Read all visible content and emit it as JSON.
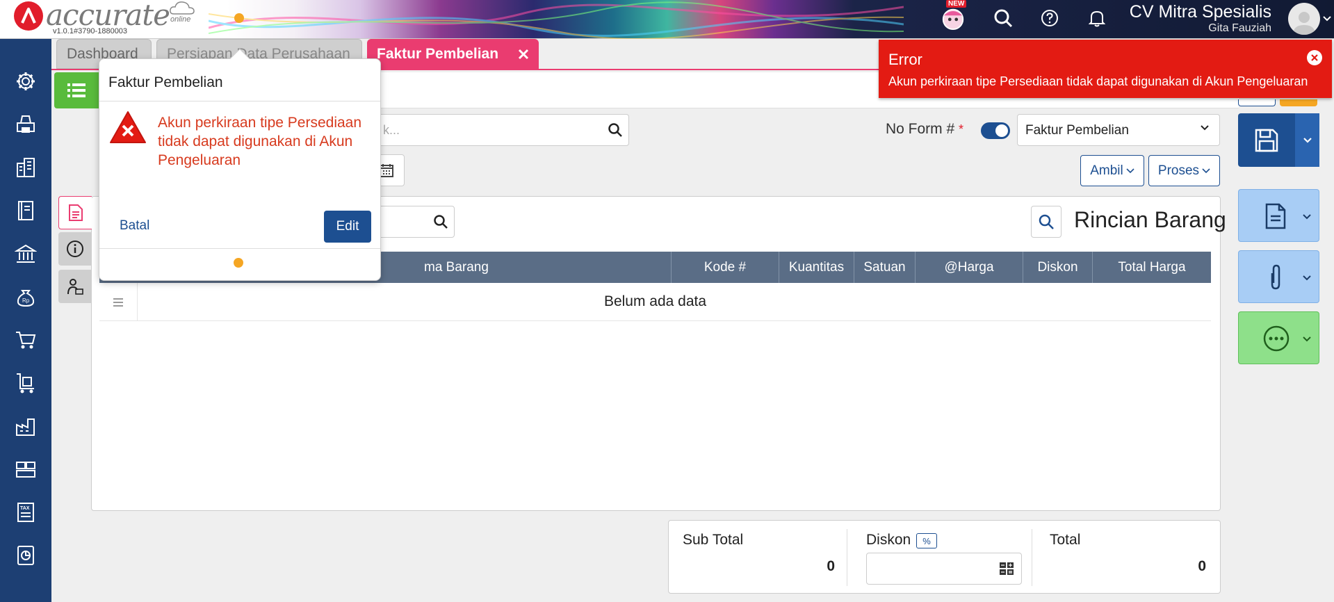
{
  "header": {
    "logo_text": "accurate",
    "logo_sub": "online",
    "version": "v1.0.1#3790-1880003",
    "new_badge": "NEW",
    "company": "CV Mitra Spesialis",
    "user": "Gita Fauziah"
  },
  "tabs": [
    {
      "label": "Dashboard"
    },
    {
      "label": "Persiapan Data Perusahaan"
    },
    {
      "label": "Faktur Pembelian"
    }
  ],
  "sidebar": {
    "icons": [
      "gear-icon",
      "printer-icon",
      "building-icon",
      "book-icon",
      "bank-icon",
      "money-bag-icon",
      "cart-icon",
      "trolley-icon",
      "factory-icon",
      "warehouse-icon",
      "tax-icon",
      "report-icon"
    ]
  },
  "form": {
    "search_placeholder": "k...",
    "no_form_label": "No Form #",
    "required_mark": "*",
    "form_select_value": "Faktur Pembelian",
    "ambil_label": "Ambil",
    "proses_label": "Proses"
  },
  "detail": {
    "section_title": "Rincian Barang",
    "columns": [
      "ma Barang",
      "Kode #",
      "Kuantitas",
      "Satuan",
      "@Harga",
      "Diskon",
      "Total Harga"
    ],
    "empty_message": "Belum ada data"
  },
  "totals": {
    "subtotal_label": "Sub Total",
    "subtotal_value": "0",
    "discount_label": "Diskon",
    "percent_label": "%",
    "total_label": "Total",
    "total_value": "0"
  },
  "toast": {
    "title": "Error",
    "message": "Akun perkiraan tipe Persediaan tidak dapat digunakan di Akun Pengeluaran"
  },
  "popover": {
    "title": "Faktur Pembelian",
    "message": "Akun perkiraan tipe Persediaan tidak dapat digunakan di Akun Pengeluaran",
    "cancel_label": "Batal",
    "edit_label": "Edit"
  },
  "colors": {
    "primary": "#1d4f91",
    "active_tab": "#ea3c70",
    "error": "#e31b13",
    "sidebar": "#1d3f73",
    "green": "#59bb3c"
  }
}
